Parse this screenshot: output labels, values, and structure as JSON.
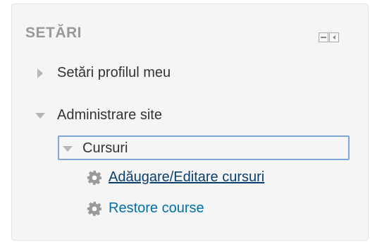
{
  "block": {
    "title": "SETĂRI",
    "controls": {
      "collapse_icon": "minus-box-icon",
      "dock_icon": "dock-left-icon"
    }
  },
  "items": {
    "profile_settings": {
      "label": "Setări profilul meu",
      "expanded": false
    },
    "site_admin": {
      "label": "Administrare site",
      "expanded": true
    },
    "courses": {
      "label": "Cursuri",
      "expanded": true
    },
    "add_edit_courses": {
      "label": "Adăugare/Editare cursuri",
      "icon": "gear-icon"
    },
    "restore_course": {
      "label": "Restore course",
      "icon": "gear-icon"
    }
  },
  "colors": {
    "link": "#0070a8",
    "focus_border": "#7ea7d8",
    "title": "#999999",
    "text": "#333333"
  }
}
